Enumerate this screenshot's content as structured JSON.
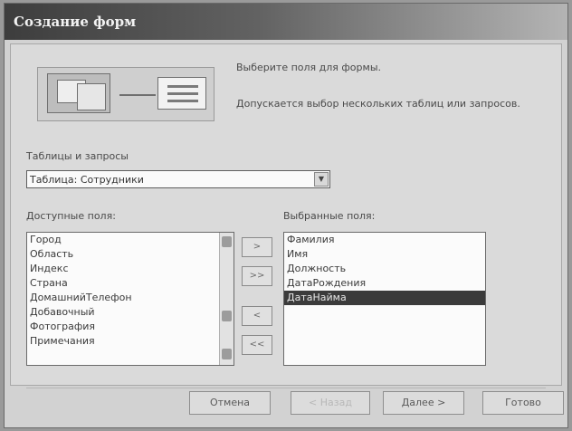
{
  "window": {
    "title": "Создание форм"
  },
  "header": {
    "prompt": "Выберите поля для формы.",
    "hint": "Допускается выбор нескольких таблиц или запросов."
  },
  "source": {
    "label": "Таблицы и запросы",
    "selected": "Таблица: Сотрудники"
  },
  "available": {
    "label": "Доступные поля:",
    "items": [
      "Город",
      "Область",
      "Индекс",
      "Страна",
      "ДомашнийТелефон",
      "Добавочный",
      "Фотография",
      "Примечания"
    ]
  },
  "selected_fields": {
    "label": "Выбранные поля:",
    "items": [
      "Фамилия",
      "Имя",
      "Должность",
      "ДатаРождения",
      "ДатаНайма"
    ],
    "active_index": 4
  },
  "move_buttons": {
    "add": ">",
    "add_all": ">>",
    "remove": "<",
    "remove_all": "<<"
  },
  "footer": {
    "cancel": "Отмена",
    "back": "< Назад",
    "next": "Далее >",
    "finish": "Готово"
  },
  "icons": {
    "dropdown": "chevron-down-icon",
    "wizard": "form-wizard-icon"
  }
}
